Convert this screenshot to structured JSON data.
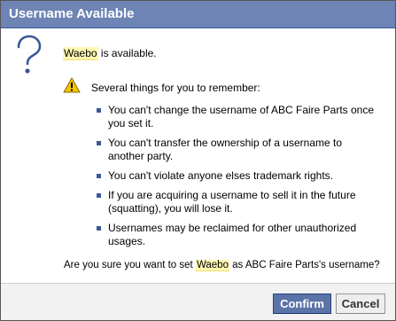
{
  "dialog": {
    "title": "Username Available",
    "username": "Waebo",
    "available_suffix": " is available.",
    "warning_heading": "Several things for you to remember:",
    "bullets": [
      "You can't change the username of ABC Faire Parts once you set it.",
      "You can't transfer the ownership of a username to another party.",
      "You can't violate anyone elses trademark rights.",
      "If you are acquiring a username to sell it in the future (squatting), you will lose it.",
      "Usernames may be reclaimed for other unauthorized usages."
    ],
    "confirm_prefix": "Are you sure you want to set ",
    "confirm_suffix": " as ABC Faire Parts's username?",
    "confirm_button": "Confirm",
    "cancel_button": "Cancel"
  },
  "icons": {
    "question": "question-mark-icon",
    "warning": "warning-triangle-icon"
  },
  "colors": {
    "title_bar": "#6d84b4",
    "confirm_button": "#5b74a8",
    "highlight": "#fff8b3",
    "warning": "#f5c400"
  }
}
